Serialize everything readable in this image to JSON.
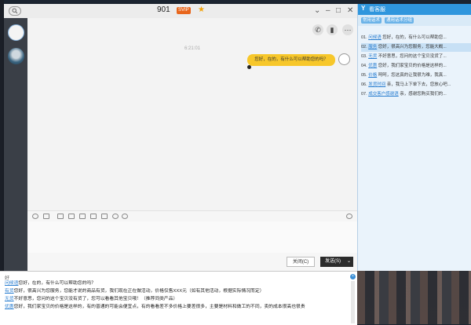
{
  "chat": {
    "contact_name": "901",
    "badge": "SVIP",
    "timestamp": "6:21:01",
    "message": "您好，在的，有什么可以帮助您的吗？",
    "close_label": "关闭(C)",
    "send_label": "发送(S)"
  },
  "quick_reply": {
    "title": "看客服",
    "tabs": [
      "常用话术",
      "通用话术分组"
    ],
    "items": [
      {
        "num": "01.",
        "kw": "问候语",
        "text": "您好，在的，有什么可以帮助您..."
      },
      {
        "num": "02.",
        "kw": "服务",
        "text": "您好，很高兴为您服务，您能大概..."
      },
      {
        "num": "03.",
        "kw": "无货",
        "text": "不好意思，您问的这个宝贝没货了..."
      },
      {
        "num": "04.",
        "kw": "优惠",
        "text": "您好，我们家宝贝的价格是这样的..."
      },
      {
        "num": "05.",
        "kw": "价格",
        "text": "呵呵，您这真的让我很为难，我真..."
      },
      {
        "num": "06.",
        "kw": "发货时间",
        "text": "亲，我马上下单下去，您放心吧..."
      },
      {
        "num": "07.",
        "kw": "成交客户感谢语",
        "text": "亲，感谢您购买我们的..."
      }
    ]
  },
  "bottom_panel": {
    "input": "好",
    "lines": [
      {
        "kw": "问候语",
        "text": "您好，在的，有什么可以帮助您的吗？"
      },
      {
        "kw": "有货",
        "text": "您好，很高兴为您服务，您能才说的商品有货，我们现在正在做活动，价格仅售XXX元（如有其他活动，根据实际情况而定）"
      },
      {
        "kw": "无货",
        "text": "不好意思，您问的这个宝贝没有货了，您可以看看其他宝贝哦！（推荐同类产品）"
      },
      {
        "kw": "优惠",
        "text": "您好，我们家宝贝的价格是这样的，有的普通的可能会便宜点，有的看看差不多价格上要差很多，主要是材料和做工的不同，卖的成本很高也很贵"
      }
    ]
  }
}
